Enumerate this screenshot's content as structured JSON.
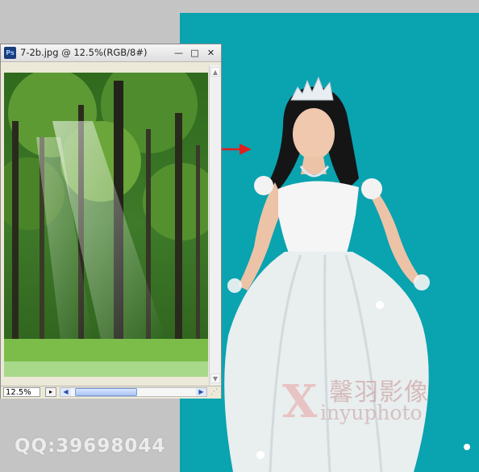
{
  "window": {
    "title": "7-2b.jpg @ 12.5%(RGB/8#)",
    "app_badge": "Ps",
    "minimize": "—",
    "maximize": "□",
    "close": "✕",
    "zoom_value": "12.5%",
    "images": {
      "document": "forest with sunbeams"
    }
  },
  "canvas": {
    "background_color": "#0aa3b0",
    "images": {
      "photo": "bride in white gown with tiara"
    }
  },
  "watermark": {
    "logo_letter": "X",
    "chinese_text": "馨羽影像",
    "english_text": "inyuphoto",
    "qq_text": "QQ:39698044"
  },
  "colors": {
    "arrow": "#e02020",
    "teal": "#0aa3b0"
  }
}
